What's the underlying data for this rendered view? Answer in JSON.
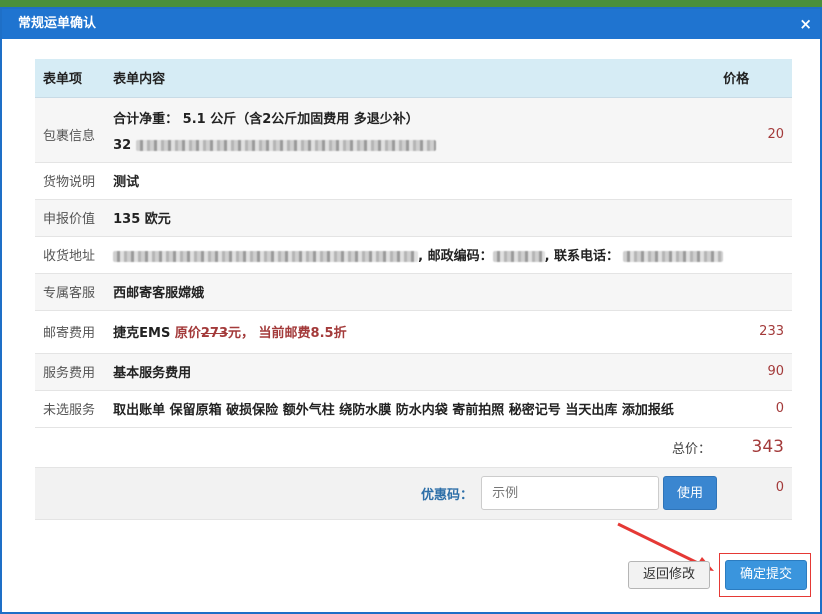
{
  "dialog": {
    "title": "常规运单确认",
    "close": "×"
  },
  "table": {
    "headers": {
      "item": "表单项",
      "content": "表单内容",
      "price": "价格"
    },
    "package": {
      "label": "包裹信息",
      "line1": "合计净重： 5.1 公斤（含2公斤加固费用 多退少补）",
      "line2_prefix": "32",
      "price": "20"
    },
    "goods": {
      "label": "货物说明",
      "content": "测试",
      "price": ""
    },
    "declared": {
      "label": "申报价值",
      "content": "135 欧元",
      "price": ""
    },
    "address": {
      "label": "收货地址",
      "zip_label": ", 邮政编码：",
      "phone_label": ", 联系电话："
    },
    "service_rep": {
      "label": "专属客服",
      "content": "西邮寄客服嫦娥"
    },
    "postage": {
      "label": "邮寄费用",
      "carrier": "捷克EMS",
      "orig_prefix": "原价",
      "orig_price": "273",
      "orig_suffix": "元，",
      "discount": "当前邮费8.5折",
      "price": "233"
    },
    "service_fee": {
      "label": "服务费用",
      "content": "基本服务费用",
      "price": "90"
    },
    "unselected": {
      "label": "未选服务",
      "content": "取出账单 保留原箱 破损保险 额外气柱 绕防水膜 防水内袋 寄前拍照 秘密记号 当天出库 添加报纸",
      "price": "0"
    },
    "total": {
      "label": "总价：",
      "value": "343"
    },
    "coupon": {
      "label": "优惠码：",
      "placeholder": "示例",
      "button": "使用",
      "value": "0"
    }
  },
  "buttons": {
    "back": "返回修改",
    "submit": "确定提交"
  },
  "colors": {
    "titlebar": "#1f74d0",
    "price": "#a33a3a",
    "primary": "#3a95dd",
    "highlight": "#e53935"
  }
}
